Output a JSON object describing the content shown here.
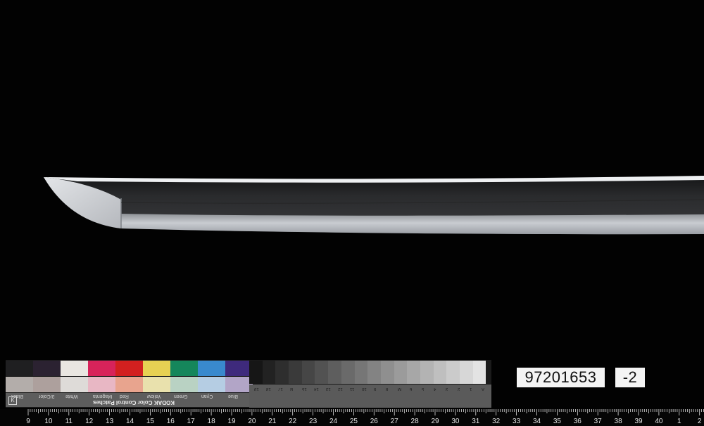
{
  "chart": {
    "brand": "KODAK Color Control Patches",
    "patch_labels": [
      "Blue",
      "Cyan",
      "Green",
      "Yellow",
      "Red",
      "Magenta",
      "White",
      "3/Color",
      "Black"
    ],
    "top_patches": [
      "#1f1f21",
      "#2b2231",
      "#e9e6e1",
      "#d7235a",
      "#d2201f",
      "#e7d153",
      "#15865b",
      "#3989cd",
      "#3e2a7c"
    ],
    "bottom_patches": [
      "#b3adaa",
      "#ada09d",
      "#dedbd8",
      "#e8b7c4",
      "#e8a48e",
      "#e9e1ad",
      "#b9d2c3",
      "#b5cde3",
      "#b2a5c7"
    ],
    "gray_scale_labels": [
      "A",
      "1",
      "2",
      "3",
      "4",
      "5",
      "6",
      "M",
      "8",
      "9",
      "10",
      "11",
      "12",
      "13",
      "14",
      "15",
      "B",
      "17",
      "18",
      "19"
    ]
  },
  "specimen": {
    "id": "97201653",
    "suffix": "-2"
  },
  "ruler": {
    "numbers": [
      "9",
      "10",
      "11",
      "12",
      "13",
      "14",
      "15",
      "16",
      "17",
      "18",
      "19",
      "20",
      "21",
      "22",
      "23",
      "24",
      "25",
      "26",
      "27",
      "28",
      "29",
      "30",
      "31",
      "32",
      "33",
      "34",
      "35",
      "36",
      "37",
      "38",
      "39",
      "40",
      "1",
      "2"
    ]
  }
}
